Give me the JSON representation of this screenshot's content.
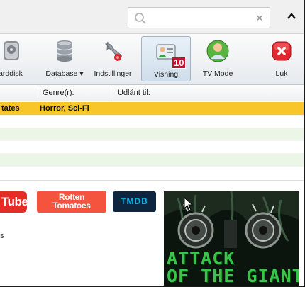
{
  "search": {
    "placeholder": "",
    "clear_glyph": "×",
    "collapse_glyph": "^"
  },
  "toolbar": [
    {
      "label": "arddisk",
      "icon": "harddisk-icon"
    },
    {
      "label": "Database ▾",
      "icon": "database-icon"
    },
    {
      "label": "Indstillinger",
      "icon": "wrench-icon"
    },
    {
      "label": "Visning",
      "icon": "view-icon",
      "active": true,
      "badge": "10"
    },
    {
      "label": "TV Mode",
      "icon": "tv-mode-icon"
    },
    {
      "label": "Luk",
      "icon": "close-icon"
    }
  ],
  "columns": [
    "Genre(r):",
    "Udlånt til:"
  ],
  "selected_row": {
    "col0": "tates",
    "genre": "Horror, Sci-Fi",
    "loaned": ""
  },
  "links": {
    "youtube": "Tube",
    "rotten_line1": "Rotten",
    "rotten_line2": "Tomatoes",
    "tmdb": "TMDB"
  },
  "stray_text": "s",
  "poster": {
    "line1": "ATTACK",
    "line2": "OF THE GIANT"
  },
  "colors": {
    "selected_row": "#f9c629",
    "alt_row": "#ecf6e7",
    "badge": "#c8102e",
    "poster_text": "#38c64a"
  }
}
